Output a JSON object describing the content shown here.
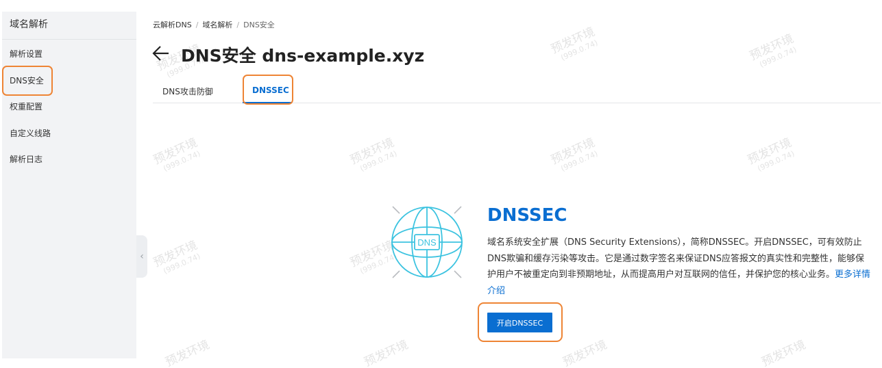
{
  "sidebar": {
    "title": "域名解析",
    "items": [
      {
        "label": "解析设置"
      },
      {
        "label": "DNS安全"
      },
      {
        "label": "权重配置"
      },
      {
        "label": "自定义线路"
      },
      {
        "label": "解析日志"
      }
    ],
    "collapse_icon": "chevron-left-icon"
  },
  "breadcrumb": {
    "items": [
      "云解析DNS",
      "域名解析",
      "DNS安全"
    ],
    "separator": "/"
  },
  "header": {
    "back_icon": "arrow-left-icon",
    "title": "DNS安全 dns-example.xyz"
  },
  "tabs": [
    {
      "label": "DNS攻击防御",
      "active": false
    },
    {
      "label": "DNSSEC",
      "active": true
    }
  ],
  "hero": {
    "icon": "globe-dns-icon",
    "icon_text": "DNS",
    "title": "DNSSEC",
    "description": "域名系统安全扩展（DNS Security Extensions），简称DNSSEC。开启DNSSEC，可有效防止DNS欺骗和缓存污染等攻击。它是通过数字签名来保证DNS应答报文的真实性和完整性，能够保护用户不被重定向到非预期地址，从而提高用户对互联网的信任，并保护您的核心业务。",
    "more_link": "更多详情介绍",
    "button_label": "开启DNSSEC"
  },
  "watermark": {
    "text": "预发环境",
    "sub": "(999.0.74)"
  },
  "colors": {
    "accent": "#0a6ed1",
    "highlight": "#ee8434",
    "sidebar_bg": "#f2f3f5",
    "globe": "#3cc3e0"
  }
}
